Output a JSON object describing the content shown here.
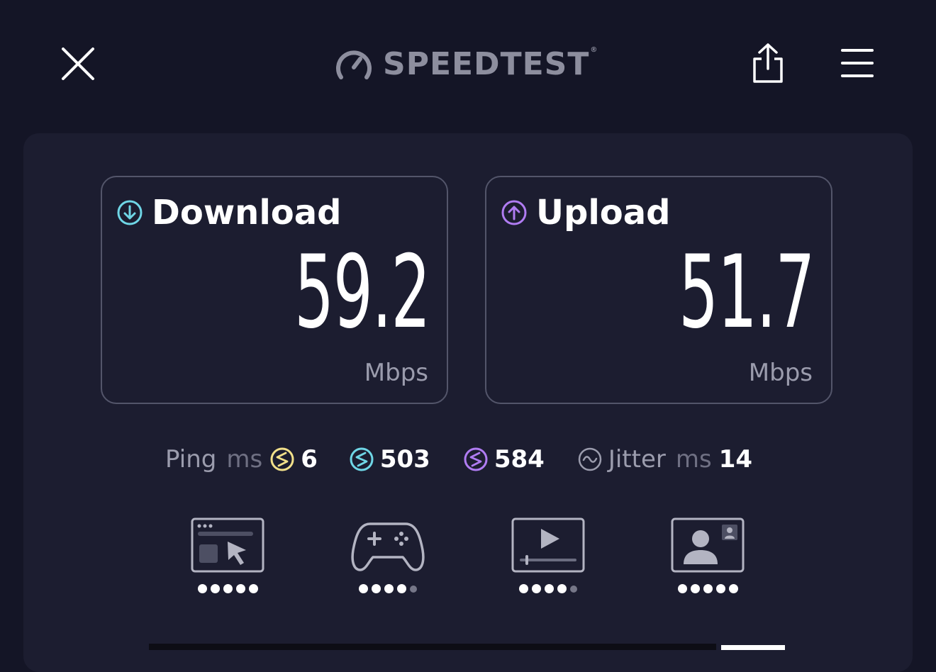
{
  "header": {
    "brand": "SPEEDTEST",
    "brand_mark": "®",
    "icons": {
      "close": "close-icon",
      "share": "share-icon",
      "menu": "menu-icon",
      "logo": "speedometer-icon"
    }
  },
  "download": {
    "title": "Download",
    "value": "59.2",
    "unit": "Mbps",
    "icon": "arrow-down-circle-icon",
    "accent": "#6fd6e6"
  },
  "upload": {
    "title": "Upload",
    "value": "51.7",
    "unit": "Mbps",
    "icon": "arrow-up-circle-icon",
    "accent": "#b07cf2"
  },
  "metrics": {
    "ping_label": "Ping",
    "ping_unit": "ms",
    "idle": {
      "value": "6",
      "color": "#f2e08a"
    },
    "download_latency": {
      "value": "503",
      "color": "#6fd6e6"
    },
    "upload_latency": {
      "value": "584",
      "color": "#b07cf2"
    },
    "jitter_label": "Jitter",
    "jitter_unit": "ms",
    "jitter_value": "14"
  },
  "experiences": [
    {
      "icon": "web-browsing-icon",
      "rating": 5,
      "max": 5
    },
    {
      "icon": "gaming-icon",
      "rating": 4,
      "max": 5
    },
    {
      "icon": "video-streaming-icon",
      "rating": 4,
      "max": 5
    },
    {
      "icon": "video-call-icon",
      "rating": 5,
      "max": 5
    }
  ]
}
